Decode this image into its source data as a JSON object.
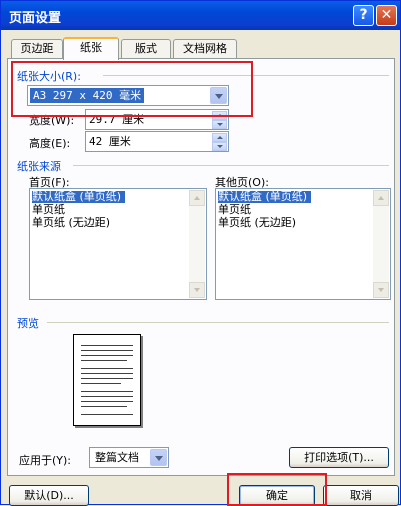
{
  "window": {
    "title": "页面设置",
    "help_glyph": "?",
    "close_glyph": "✕"
  },
  "tabs": [
    {
      "label": "页边距",
      "active": false
    },
    {
      "label": "纸张",
      "active": true
    },
    {
      "label": "版式",
      "active": false
    },
    {
      "label": "文档网格",
      "active": false
    }
  ],
  "paper_size": {
    "label": "纸张大小(R):",
    "selected": "A3 297 x 420 毫米",
    "width_label": "宽度(W):",
    "width_value": "29.7 厘米",
    "height_label": "高度(E):",
    "height_value": "42 厘米"
  },
  "paper_source": {
    "label": "纸张来源",
    "first_page_label": "首页(F):",
    "first_page_items": [
      "默认纸盒 (单页纸)",
      "单页纸",
      "单页纸 (无边距)"
    ],
    "first_page_selected_index": 0,
    "other_pages_label": "其他页(O):",
    "other_pages_items": [
      "默认纸盒 (单页纸)",
      "单页纸",
      "单页纸 (无边距)"
    ],
    "other_pages_selected_index": 0
  },
  "preview": {
    "label": "预览"
  },
  "apply_to": {
    "label": "应用于(Y):",
    "value": "整篇文档"
  },
  "buttons": {
    "print_options": "打印选项(T)...",
    "default": "默认(D)...",
    "ok": "确定",
    "cancel": "取消"
  },
  "colors": {
    "title_bar": "#0a5ee6",
    "selection": "#316ac5",
    "highlight_annotation": "#e01b24",
    "active_tab_accent": "#f8b33d"
  }
}
